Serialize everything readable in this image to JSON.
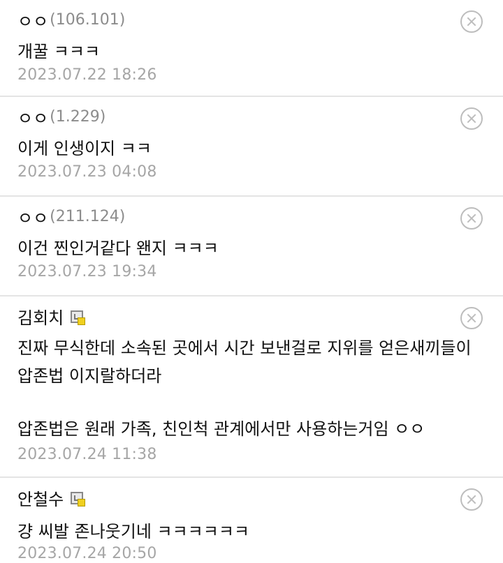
{
  "comments": [
    {
      "nick": "ㅇㅇ",
      "ip": "(106.101)",
      "lines": [
        "개꿀 ㅋㅋㅋ"
      ],
      "date": "2023.07.22 18:26"
    },
    {
      "nick": "ㅇㅇ",
      "ip": "(1.229)",
      "lines": [
        "이게 인생이지 ㅋㅋ"
      ],
      "date": "2023.07.23 04:08"
    },
    {
      "nick": "ㅇㅇ",
      "ip": "(211.124)",
      "lines": [
        "이건 찐인거같다 왠지 ㅋㅋㅋ"
      ],
      "date": "2023.07.23 19:34"
    },
    {
      "nick": "김회치",
      "badge_icon": "member-badge-icon",
      "lines": [
        "진짜 무식한데 소속된 곳에서 시간 보낸걸로 지위를 얻은새끼들이",
        "압존법 이지랄하더라",
        "",
        "압존법은 원래 가족, 친인척 관계에서만 사용하는거임 ㅇㅇ"
      ],
      "date": "2023.07.24 11:38"
    },
    {
      "nick": "안철수",
      "badge_icon": "member-badge-icon",
      "lines": [
        "걍 씨발 존나웃기네 ㅋㅋㅋㅋㅋㅋ"
      ],
      "date": "2023.07.24 20:50"
    }
  ],
  "delete_icon": "close-circle-icon",
  "colors": {
    "nick": "#111111",
    "ip": "#8c8c8c",
    "date": "#a6a6a6",
    "divider": "#e4e4e4",
    "delete": "#bdbdbd"
  }
}
